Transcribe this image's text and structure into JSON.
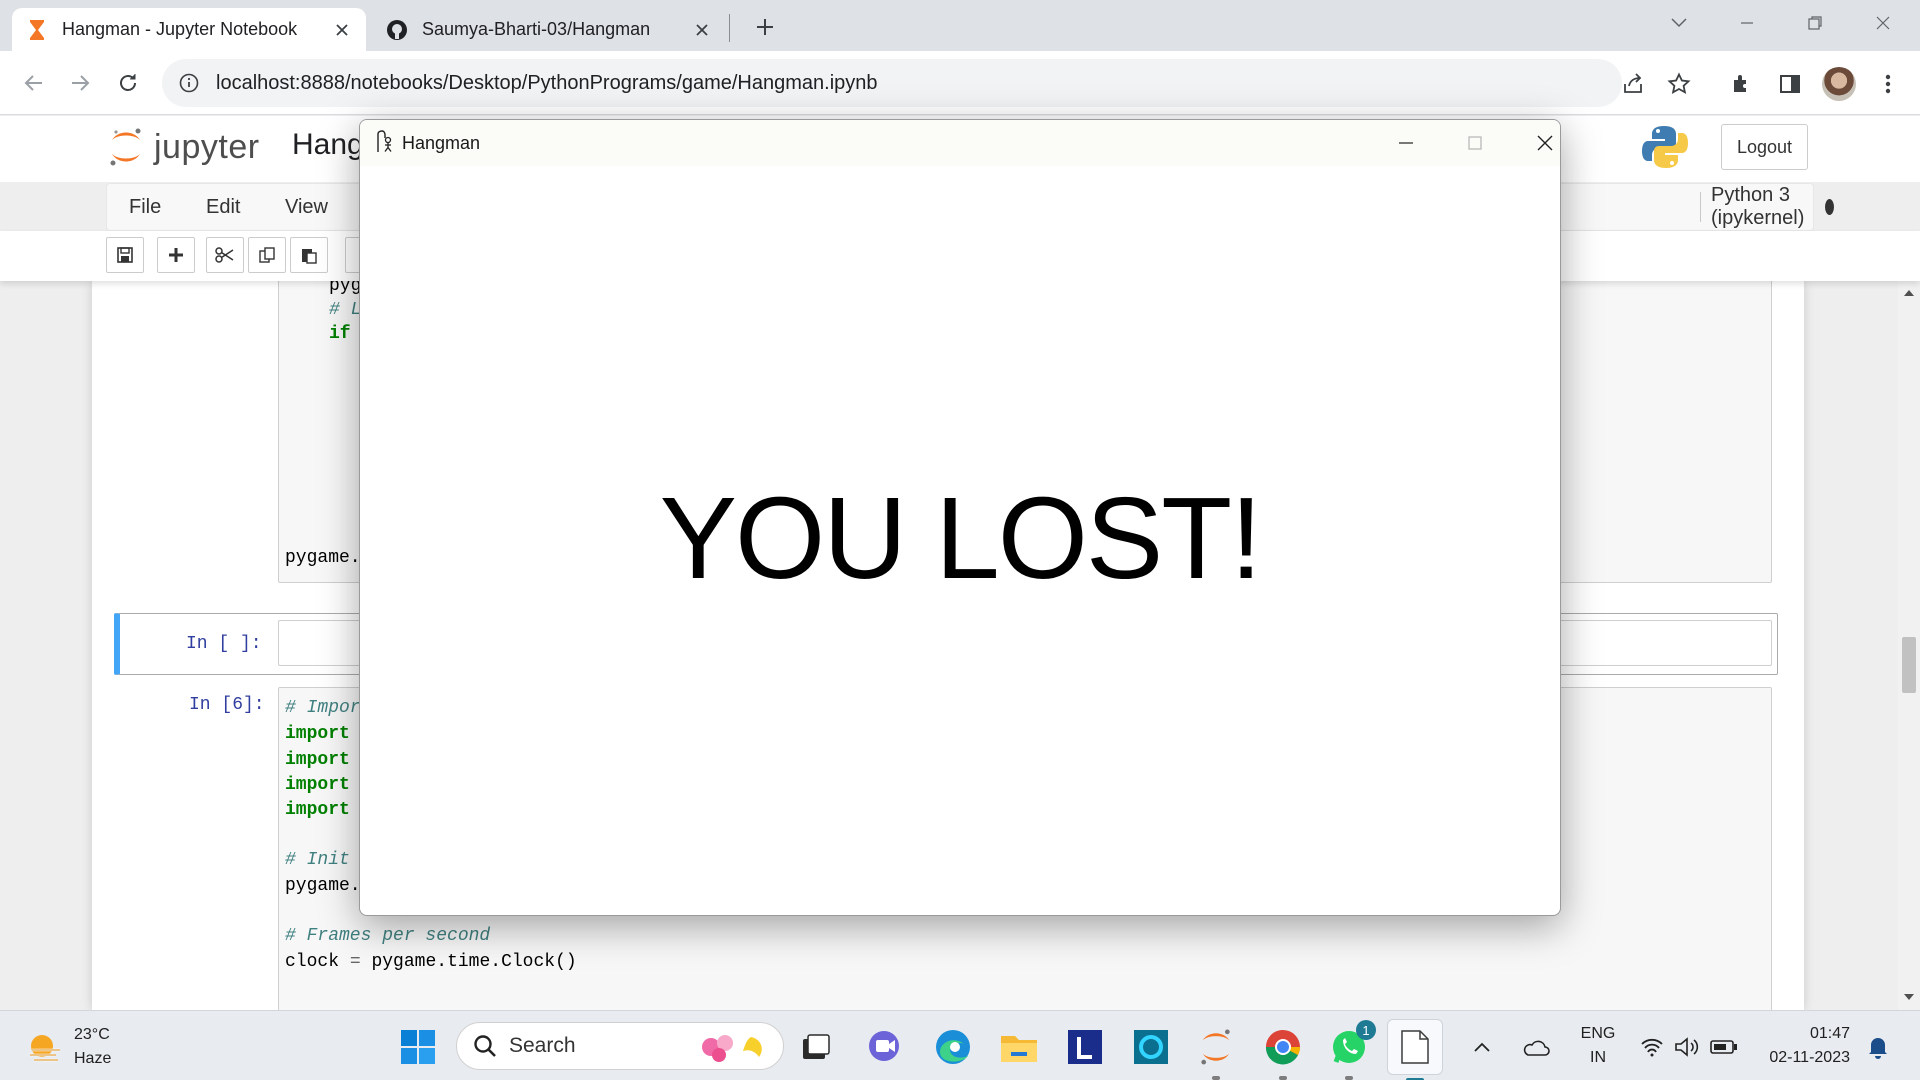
{
  "browser": {
    "tabs": [
      {
        "title": "Hangman - Jupyter Notebook",
        "active": true
      },
      {
        "title": "Saumya-Bharti-03/Hangman",
        "active": false
      }
    ],
    "url": "localhost:8888/notebooks/Desktop/PythonPrograms/game/Hangman.ipynb"
  },
  "jupyter": {
    "logo_text": "jupyter",
    "notebook_title": "Hang",
    "logout_label": "Logout",
    "menus": [
      "File",
      "Edit",
      "View"
    ],
    "kernel_label": "Python 3 (ipykernel)"
  },
  "notebook": {
    "cell1_lines": [
      "pyg",
      "# L",
      "if",
      "pygame."
    ],
    "cell2_prompt": "In [ ]:",
    "cell3_prompt": "In [6]:",
    "cell3": {
      "line1": "# Impor",
      "import_kw": "import",
      "line_init": "# Init",
      "line_pygame": "pygame.",
      "line_fps": "# Frames per second",
      "clock_var": "clock",
      "clock_eq": "=",
      "clock_call": "pygame.time.Clock()"
    }
  },
  "game_window": {
    "title": "Hangman",
    "message": "YOU LOST!"
  },
  "taskbar": {
    "weather_temp": "23°C",
    "weather_desc": "Haze",
    "search_label": "Search",
    "whatsapp_badge": "1",
    "lang_top": "ENG",
    "lang_bottom": "IN",
    "time": "01:47",
    "date": "02-11-2023"
  },
  "colors": {
    "jupyter_orange": "#f37726",
    "selected_cell_border": "#42a5f5",
    "prompt_blue": "#303f9f",
    "keyword_green": "#008000",
    "comment_teal": "#408080"
  }
}
